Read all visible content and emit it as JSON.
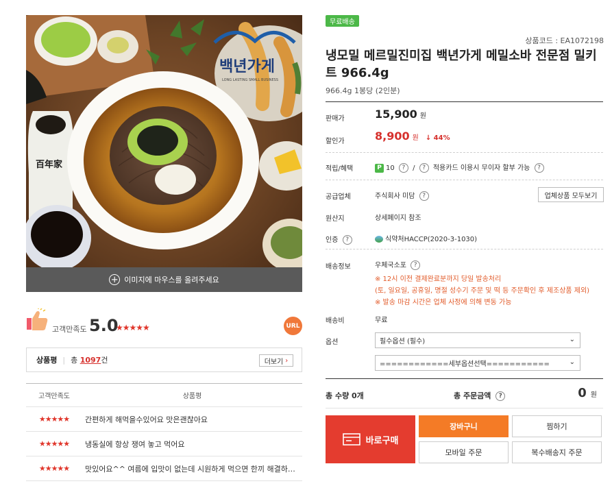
{
  "gallery": {
    "logo_text": "백년가게",
    "logo_sub": "LONG LASTING SMALL BUSINESS",
    "bottle_text": "百年家",
    "hover_hint": "이미지에 마우스를 올려주세요"
  },
  "satisfaction": {
    "label": "고객만족도",
    "score": "5.0",
    "stars": "★★★★★",
    "url_badge": "URL"
  },
  "reviews": {
    "title": "상품평",
    "total_prefix": "총",
    "count": "1097",
    "count_suffix": "건",
    "more_label": "더보기",
    "col_rating": "고객만족도",
    "col_review": "상품평",
    "rows": [
      {
        "stars": "★★★★★",
        "text": "간편하게 해먹을수있어요 맛은괜찮아요"
      },
      {
        "stars": "★★★★★",
        "text": "냉동실에 항상 쟁여 놓고 먹어요"
      },
      {
        "stars": "★★★★★",
        "text": "맛있어요^^ 여름에 입맛이 없는데 시원하게 먹으면 한끼 해결하는데 …"
      }
    ]
  },
  "product": {
    "badge": "무료배송",
    "code": "상품코드 : EA1072198",
    "title": "냉모밀 메르밀진미집 백년가게 메밀소바 전문점 밀키트 966.4g",
    "subtitle": "966.4g 1봉당 (2인분)"
  },
  "pricing": {
    "list_label": "판매가",
    "list_price": "15,900",
    "won": "원",
    "sale_label": "할인가",
    "sale_price": "8,900",
    "discount": "↓ 44%"
  },
  "points": {
    "label": "적립/혜택",
    "badge": "P",
    "value": "10",
    "separator": "/",
    "text": "적용카드 이용시 무이자 할부 가능"
  },
  "supplier": {
    "label": "공급업체",
    "value": "주식회사 미담",
    "all_button": "업체상품 모두보기"
  },
  "origin": {
    "label": "원산지",
    "value": "상세페이지 참조"
  },
  "cert": {
    "label": "인증",
    "value": "식약처HACCP(2020-3-1030)"
  },
  "shipping": {
    "label": "배송정보",
    "method": "우체국소포",
    "notice1": "※ 12시 이전 결제완료분까지 당일 발송처리",
    "notice2": "(토, 일요일, 공휴일, 명절 성수기 주문 및 떡 등 주문확인 후 제조상품 제외)",
    "notice3": "※ 발송 마감 시간은 업체 사정에 의해 변동 가능"
  },
  "fee": {
    "label": "배송비",
    "value": "무료"
  },
  "options": {
    "label": "옵션",
    "select1": "필수옵션 (필수)",
    "select2": "============세부옵션선택==========="
  },
  "totals": {
    "qty": "총 수량 0개",
    "amount_label": "총 주문금액",
    "amount": "0",
    "won": "원"
  },
  "actions": {
    "buy": "바로구매",
    "cart": "장바구니",
    "wish": "찜하기",
    "mobile": "모바일 주문",
    "multi": "복수배송지 주문"
  },
  "colors": {
    "accent_red": "#e43c2f",
    "cart_orange": "#f47b26",
    "free_green": "#4cb848",
    "star_red": "#e0362b"
  }
}
